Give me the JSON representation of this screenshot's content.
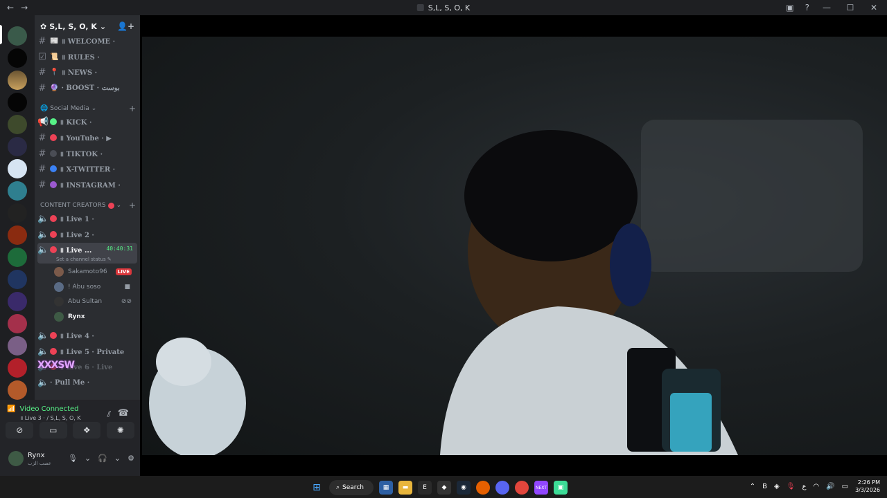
{
  "titlebar": {
    "title": "S,L, S, O, K",
    "back": "←",
    "forward": "→",
    "minimize": "—",
    "maximize": "☐",
    "close": "✕"
  },
  "server": {
    "name": "S,L, S, O, K"
  },
  "channels": [
    {
      "label": "॥ WELCOME ·",
      "emoji": "📰",
      "type": "text"
    },
    {
      "label": "॥ RULES ·",
      "emoji": "📜",
      "type": "rules"
    },
    {
      "label": "॥ NEWS ·",
      "emoji": "📍",
      "type": "text"
    },
    {
      "label": "· BOOST · بوست",
      "emoji": "🔮",
      "type": "text"
    }
  ],
  "social_category": "Social Media",
  "social_channels": [
    {
      "label": "॥ KICK ·",
      "dot": "#57f287",
      "type": "announce"
    },
    {
      "label": "॥ YouTube · ▶",
      "dot": "#ed4256",
      "type": "text"
    },
    {
      "label": "॥ TIKTOK ·",
      "dot": "#4a4d55",
      "type": "text"
    },
    {
      "label": "॥ X-TWITTER ·",
      "dot": "#3b82f6",
      "type": "text"
    },
    {
      "label": "॥ INSTAGRAM ·",
      "dot": "#9b59d0",
      "type": "text"
    }
  ],
  "creators_category": "CONTENT CREATORS",
  "voice_channels": [
    {
      "label": "॥ Live 1 ·"
    },
    {
      "label": "॥ Live 2 ·"
    }
  ],
  "active_voice": {
    "label": "॥ Live ...",
    "timer": "40:40:31",
    "status": "Set a channel status"
  },
  "voice_users": [
    {
      "name": "Sakamoto96",
      "badge": "LIVE"
    },
    {
      "name": "! Abu soso"
    },
    {
      "name": "Abu Sultan"
    },
    {
      "name": "Rynx"
    }
  ],
  "more_voice": [
    {
      "label": "॥ Live 4 ·"
    },
    {
      "label": "॥ Live 5 · Private"
    },
    {
      "label": "॥ Live 6 · Live"
    },
    {
      "label": "· Pull Me ·"
    }
  ],
  "overlay": "XXXSW",
  "voice_panel": {
    "status": "Video Connected",
    "channel": "॥ Live 3 · / S,L, S, O, K"
  },
  "user": {
    "name": "Rynx",
    "status": "عصب الزب"
  },
  "taskbar": {
    "search": "Search",
    "time": "2:26 PM",
    "date": "3/3/2026",
    "lang": "ع"
  }
}
